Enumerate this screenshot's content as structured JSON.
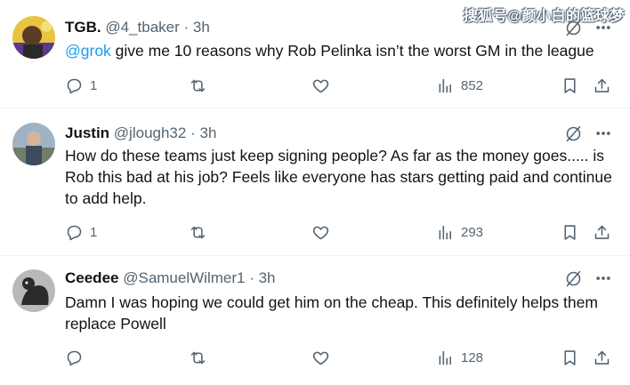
{
  "watermark": "搜狐号@颜小白的篮球梦",
  "posts": [
    {
      "name": "TGB.",
      "handle": "@4_tbaker",
      "dot": "·",
      "time": "3h",
      "mention": "@grok",
      "text": " give me 10 reasons why Rob Pelinka isn’t the worst GM in the league",
      "replies": "1",
      "reposts": "",
      "likes": "",
      "views": "852"
    },
    {
      "name": "Justin",
      "handle": "@jlough32",
      "dot": "·",
      "time": "3h",
      "text": "How do these teams just keep signing people? As far as the money goes..... is Rob this bad at his job? Feels like everyone has stars getting paid and continue to add help.",
      "replies": "1",
      "reposts": "",
      "likes": "",
      "views": "293"
    },
    {
      "name": "Ceedee",
      "handle": "@SamuelWilmer1",
      "dot": "·",
      "time": "3h",
      "text": "Damn I was hoping we could get him on the cheap. This definitely helps them replace Powell",
      "replies": "",
      "reposts": "",
      "likes": "",
      "views": "128"
    }
  ],
  "icons": {
    "reply": "reply-icon",
    "repost": "repost-icon",
    "like": "heart-icon",
    "views": "views-icon",
    "bookmark": "bookmark-icon",
    "share": "share-icon",
    "grok": "grok-icon",
    "more": "more-icon"
  }
}
